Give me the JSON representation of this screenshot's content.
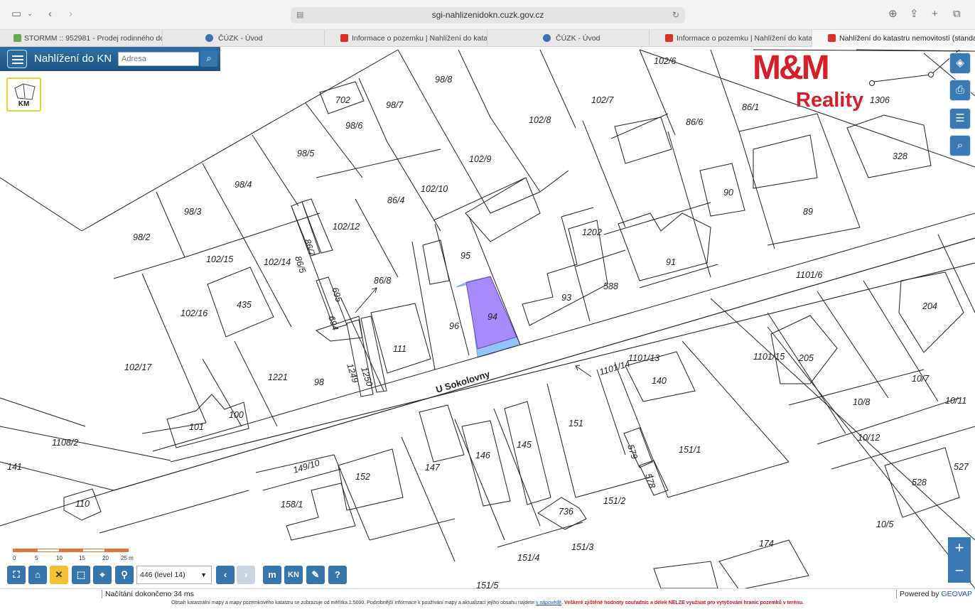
{
  "browser": {
    "url": "sgi-nahlizenidokn.cuzk.gov.cz",
    "tabs": [
      {
        "label": "STORMM :: 952981 - Prodej rodinného do...",
        "favicon_color": "#6aa84f"
      },
      {
        "label": "ČÚZK - Úvod",
        "favicon_color": "#3d6fb2"
      },
      {
        "label": "Informace o pozemku | Nahlížení do katast...",
        "favicon_color": "#d9322b"
      },
      {
        "label": "ČÚZK - Úvod",
        "favicon_color": "#3d6fb2"
      },
      {
        "label": "Informace o pozemku | Nahlížení do katast...",
        "favicon_color": "#d9322b"
      },
      {
        "label": "Nahlížení do katastru nemovitostí (standard)",
        "favicon_color": "#d9322b",
        "active": true
      }
    ]
  },
  "app": {
    "title": "Nahlížení do KN",
    "address_placeholder": "Adresa",
    "km_label": "KM",
    "level_select": "446 (level 14)",
    "tool_m": "m",
    "tool_kn": "KN",
    "tool_help": "?"
  },
  "brand": {
    "line1": "M&M",
    "line2": "Reality",
    "color": "#d61f26"
  },
  "scale": {
    "ticks": [
      "0",
      "5",
      "10",
      "15",
      "20",
      "25 m"
    ]
  },
  "map": {
    "street_label": "U Sokolovny",
    "selected_parcel": "94",
    "highlight_colors": {
      "parcel": "#a78bfa",
      "adjacent": "#93c5fd"
    },
    "parcels": [
      "98/8",
      "102/6",
      "102/7",
      "86/1",
      "1306",
      "702",
      "98/7",
      "102/8",
      "86/6",
      "328",
      "98/6",
      "98/5",
      "102/9",
      "98/4",
      "86/4",
      "102/10",
      "90",
      "89",
      "98/3",
      "86/7",
      "102/12",
      "1202",
      "98/2",
      "86/5",
      "102/15",
      "102/14",
      "95",
      "91",
      "1101/6",
      "695",
      "86/8",
      "93",
      "588",
      "435",
      "694",
      "204",
      "102/16",
      "94",
      "96",
      "111",
      "1101/15",
      "1249",
      "1250",
      "1101/13",
      "1101/14",
      "205",
      "102/17",
      "1221",
      "98",
      "140",
      "10/7",
      "10/8",
      "10/11",
      "100",
      "101",
      "151",
      "10/12",
      "1108/2",
      "145",
      "146",
      "147",
      "579",
      "151/1",
      "527",
      "578",
      "141",
      "149/10",
      "152",
      "528",
      "158/1",
      "110",
      "151/2",
      "736",
      "10/5",
      "151/3",
      "174",
      "151/4",
      "151/5"
    ]
  },
  "status": {
    "loading": "Načítání dokončeno 34 ms",
    "powered_prefix": "Powered by ",
    "powered_brand": "GEOVAP",
    "footer_text": "Obsah katastrální mapy a mapy pozemkového katastru se zobrazuje od měřítka 1:5000. Podrobnější informace k používání mapy a aktualizaci jejího obsahu najdete",
    "footer_link": "v nápovědě",
    "footer_warning": "Veškeré zjištěné hodnoty souřadnic a délek NELZE využívat pro vytyčování hranic pozemků v terénu."
  }
}
